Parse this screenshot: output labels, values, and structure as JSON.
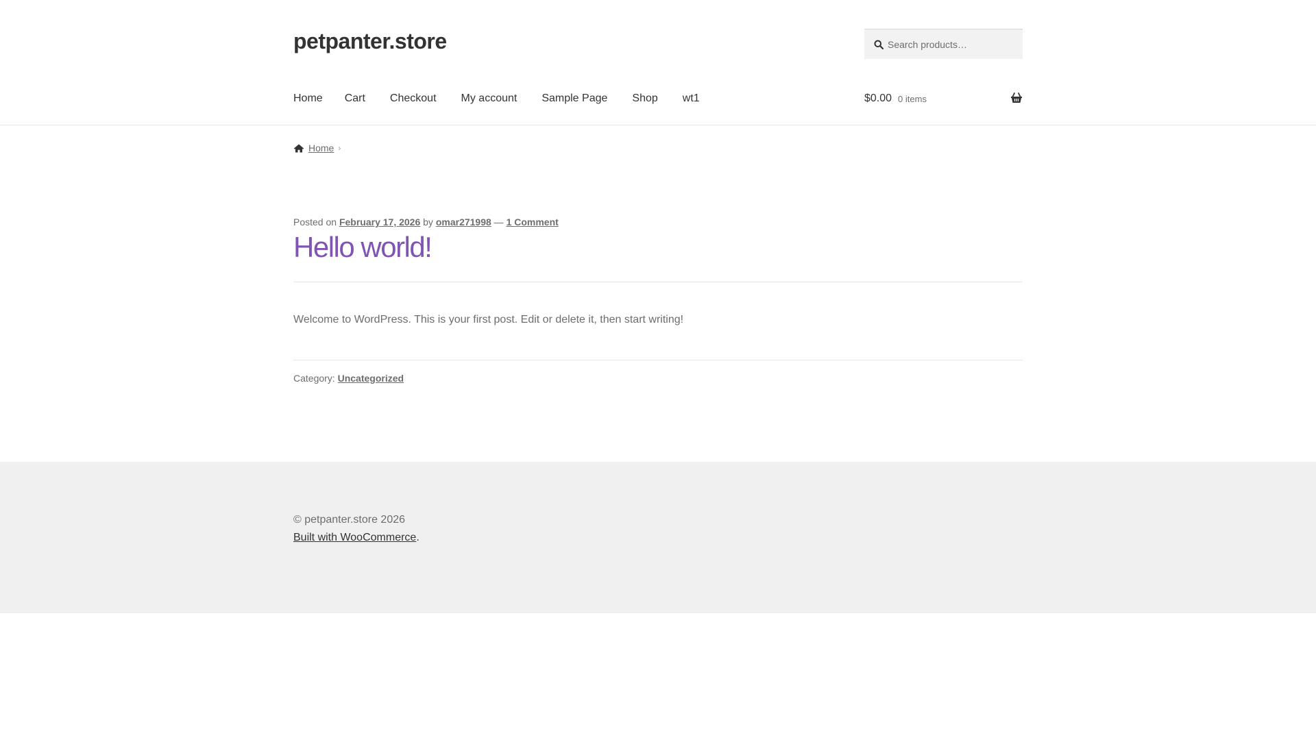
{
  "site": {
    "title": "petpanter.store"
  },
  "search": {
    "placeholder": "Search products…"
  },
  "nav": {
    "items": [
      {
        "label": "Home"
      },
      {
        "label": "Cart"
      },
      {
        "label": "Checkout"
      },
      {
        "label": "My account"
      },
      {
        "label": "Sample Page"
      },
      {
        "label": "Shop"
      },
      {
        "label": "wt1"
      }
    ]
  },
  "cart": {
    "amount": "$0.00",
    "count": "0 items"
  },
  "breadcrumb": {
    "home": "Home"
  },
  "post": {
    "posted_on": "Posted on",
    "date": "February 17, 2026",
    "by": "by",
    "author": "omar271998",
    "dash": "—",
    "comments": "1 Comment",
    "title": "Hello world!",
    "content": "Welcome to WordPress. This is your first post. Edit or delete it, then start writing!",
    "category_label": "Category:",
    "category": "Uncategorized"
  },
  "footer": {
    "copyright": "© petpanter.store 2026",
    "built_with": "Built with WooCommerce",
    "built_with_suffix": "."
  },
  "colors": {
    "accent": "#7f54b3",
    "text": "#6d6d6d",
    "heading": "#333333",
    "footer_bg": "#f0f0f0"
  }
}
